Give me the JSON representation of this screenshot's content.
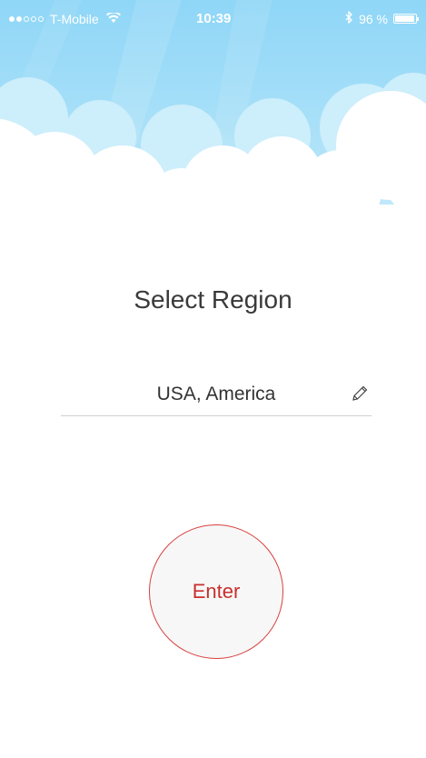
{
  "status_bar": {
    "carrier": "T-Mobile",
    "time": "10:39",
    "battery": "96 %",
    "battery_level": 0.96,
    "signal_bars": 2,
    "icons": [
      "signal-icon",
      "wifi-icon",
      "bluetooth-icon",
      "battery-icon"
    ]
  },
  "header": {
    "illustration": "sky-clouds",
    "sky_color": "#a8e0f8",
    "cloud_color": "#ffffff"
  },
  "main": {
    "title": "Select Region",
    "region": {
      "value": "USA, America",
      "edit_icon": "pencil-icon"
    },
    "enter_label": "Enter"
  },
  "colors": {
    "accent": "#d9413f",
    "text": "#3a3a3a"
  }
}
